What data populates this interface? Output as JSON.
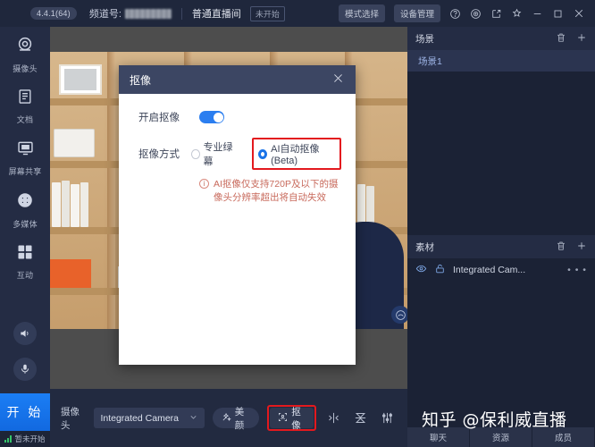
{
  "topbar": {
    "version": "4.4.1(64)",
    "channel_label": "频道号:",
    "channel_value_masked": "",
    "room_type": "普通直播间",
    "status_chip": "未开始",
    "mode_button": "模式选择",
    "device_button": "设备管理",
    "icons": [
      "help-icon",
      "target-icon",
      "external-link-icon",
      "pin-icon",
      "minimize-icon",
      "maximize-icon",
      "close-icon"
    ]
  },
  "sidebar": {
    "items": [
      {
        "label": "摄像头",
        "icon": "camera-icon"
      },
      {
        "label": "文档",
        "icon": "document-icon"
      },
      {
        "label": "屏幕共享",
        "icon": "screen-share-icon"
      },
      {
        "label": "多媒体",
        "icon": "multimedia-icon"
      },
      {
        "label": "互动",
        "icon": "interaction-icon"
      }
    ],
    "speaker_icon": "speaker-icon",
    "mic_icon": "microphone-icon",
    "start_button": "开 始",
    "status_text": "暂未开始"
  },
  "modal": {
    "title": "抠像",
    "close_icon": "close-icon",
    "enable_label": "开启抠像",
    "enable_on": true,
    "method_label": "抠像方式",
    "option_greenscreen": "专业绿幕",
    "option_ai": "AI自动抠像(Beta)",
    "selected_option": "AI自动抠像(Beta)",
    "warning": "AI抠像仅支持720P及以下的摄像头分辨率超出将自动失效",
    "highlight_color": "#e3191e"
  },
  "bottombar": {
    "camera_label": "摄像头",
    "camera_selected": "Integrated Camera",
    "beauty_button": "美颜",
    "keying_button": "抠像",
    "icons": [
      "mirror-flip-icon",
      "align-center-icon",
      "audio-sliders-icon"
    ]
  },
  "right_panel": {
    "scene": {
      "title": "场景",
      "delete_icon": "trash-icon",
      "add_icon": "plus-icon",
      "items": [
        "场景1"
      ]
    },
    "material": {
      "title": "素材",
      "delete_icon": "trash-icon",
      "add_icon": "plus-icon",
      "rows": [
        {
          "name": "Integrated Cam...",
          "visible_icon": "eye-icon",
          "lock_icon": "unlock-icon",
          "more_icon": "more-icon"
        }
      ]
    },
    "tabs": [
      "聊天",
      "资源",
      "成员"
    ]
  },
  "watermark": "知乎 @保利威直播",
  "colors": {
    "accent_blue": "#1a73e8",
    "highlight_red": "#e3191e",
    "panel_dark": "#242c44",
    "bg_dark": "#1b2235",
    "start_green_signal": "#35c46a"
  }
}
